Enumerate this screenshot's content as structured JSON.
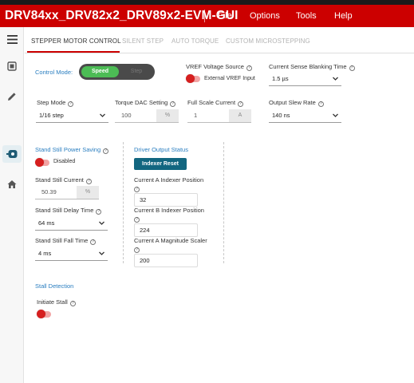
{
  "app": {
    "title": "DRV84xx_DRV82x2_DRV89x2-EVM-GUI",
    "menu": [
      "File",
      "Options",
      "Tools",
      "Help"
    ]
  },
  "sidebar": {
    "icons": [
      "menu-icon",
      "register-map-icon",
      "pencil-icon",
      "motor-icon",
      "home-icon"
    ]
  },
  "tabs": [
    "STEPPER MOTOR CONTROL",
    "SILENT STEP",
    "AUTO TORQUE",
    "CUSTOM MICROSTEPPING"
  ],
  "control_mode": {
    "label": "Control Mode:",
    "options": [
      "Speed",
      "Step"
    ],
    "selected": "Speed"
  },
  "vref": {
    "label": "VREF Voltage Source",
    "toggle_label": "External VREF Input",
    "enabled": false
  },
  "blanking": {
    "label": "Current Sense Blanking Time",
    "value": "1.5 µs"
  },
  "step_mode": {
    "label": "Step Mode",
    "value": "1/16 step"
  },
  "torque_dac": {
    "label": "Torque DAC Setting",
    "value": "100",
    "unit": "%"
  },
  "full_scale": {
    "label": "Full Scale Current",
    "value": "1",
    "unit": "A"
  },
  "slew_rate": {
    "label": "Output Slew Rate",
    "value": "140 ns"
  },
  "standstill": {
    "title": "Stand Still Power Saving",
    "toggle_label": "Disabled",
    "enabled": false,
    "current_label": "Stand Still Current",
    "current_value": "50.39",
    "current_unit": "%",
    "delay_label": "Stand Still Delay Time",
    "delay_value": "64 ms",
    "fall_label": "Stand Still Fall Time",
    "fall_value": "4 ms"
  },
  "driver_status": {
    "title": "Driver Output Status",
    "reset_button": "Indexer Reset",
    "a_index_label": "Current A Indexer Position",
    "a_index_value": "32",
    "b_index_label": "Current B Indexer Position",
    "b_index_value": "224",
    "a_mag_label": "Current A Magnitude Scaler",
    "a_mag_value": "200"
  },
  "stall": {
    "title": "Stall Detection",
    "initiate_label": "Initiate Stall",
    "enabled": false
  },
  "colors": {
    "brand_red": "#cc0000",
    "link_blue": "#2a7ec0",
    "button_teal": "#126680",
    "toggle_green": "#4cbc55"
  }
}
